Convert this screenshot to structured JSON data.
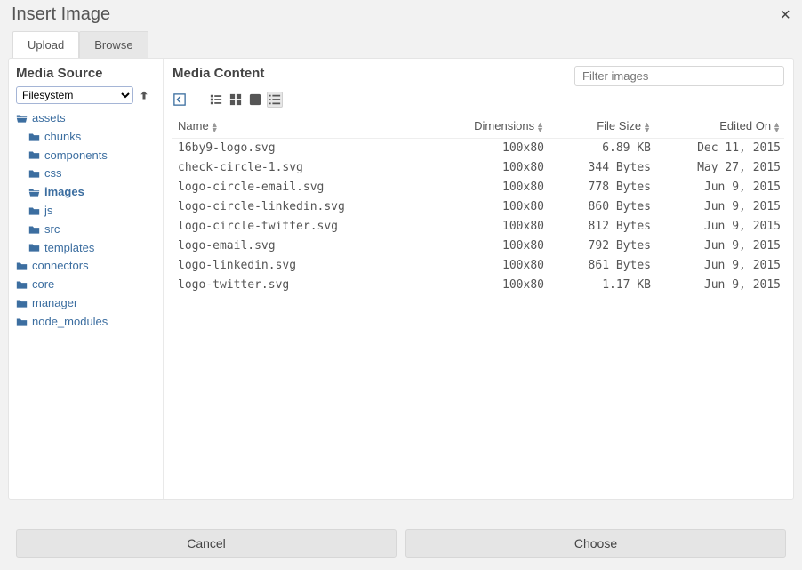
{
  "dialog": {
    "title": "Insert Image"
  },
  "tabs": {
    "upload": "Upload",
    "browse": "Browse"
  },
  "left": {
    "title": "Media Source",
    "source_options": [
      "Filesystem"
    ],
    "source_selected": "Filesystem",
    "tree": [
      {
        "id": "assets",
        "label": "assets",
        "level": 0,
        "open": true,
        "selected": false
      },
      {
        "id": "chunks",
        "label": "chunks",
        "level": 1,
        "open": false,
        "selected": false
      },
      {
        "id": "components",
        "label": "components",
        "level": 1,
        "open": false,
        "selected": false
      },
      {
        "id": "css",
        "label": "css",
        "level": 1,
        "open": false,
        "selected": false
      },
      {
        "id": "images",
        "label": "images",
        "level": 1,
        "open": true,
        "selected": true
      },
      {
        "id": "js",
        "label": "js",
        "level": 1,
        "open": false,
        "selected": false
      },
      {
        "id": "src",
        "label": "src",
        "level": 1,
        "open": false,
        "selected": false
      },
      {
        "id": "templates",
        "label": "templates",
        "level": 1,
        "open": false,
        "selected": false
      },
      {
        "id": "connectors",
        "label": "connectors",
        "level": 0,
        "open": false,
        "selected": false
      },
      {
        "id": "core",
        "label": "core",
        "level": 0,
        "open": false,
        "selected": false
      },
      {
        "id": "manager",
        "label": "manager",
        "level": 0,
        "open": false,
        "selected": false
      },
      {
        "id": "node_modules",
        "label": "node_modules",
        "level": 0,
        "open": false,
        "selected": false
      }
    ]
  },
  "right": {
    "title": "Media Content",
    "filter_placeholder": "Filter images",
    "columns": {
      "name": "Name",
      "dim": "Dimensions",
      "size": "File Size",
      "date": "Edited On"
    },
    "rows": [
      {
        "name": "16by9-logo.svg",
        "dim": "100x80",
        "size": "6.89 KB",
        "date": "Dec 11, 2015"
      },
      {
        "name": "check-circle-1.svg",
        "dim": "100x80",
        "size": "344 Bytes",
        "date": "May 27, 2015"
      },
      {
        "name": "logo-circle-email.svg",
        "dim": "100x80",
        "size": "778 Bytes",
        "date": "Jun 9, 2015"
      },
      {
        "name": "logo-circle-linkedin.svg",
        "dim": "100x80",
        "size": "860 Bytes",
        "date": "Jun 9, 2015"
      },
      {
        "name": "logo-circle-twitter.svg",
        "dim": "100x80",
        "size": "812 Bytes",
        "date": "Jun 9, 2015"
      },
      {
        "name": "logo-email.svg",
        "dim": "100x80",
        "size": "792 Bytes",
        "date": "Jun 9, 2015"
      },
      {
        "name": "logo-linkedin.svg",
        "dim": "100x80",
        "size": "861 Bytes",
        "date": "Jun 9, 2015"
      },
      {
        "name": "logo-twitter.svg",
        "dim": "100x80",
        "size": "1.17 KB",
        "date": "Jun 9, 2015"
      }
    ]
  },
  "footer": {
    "cancel": "Cancel",
    "choose": "Choose"
  }
}
